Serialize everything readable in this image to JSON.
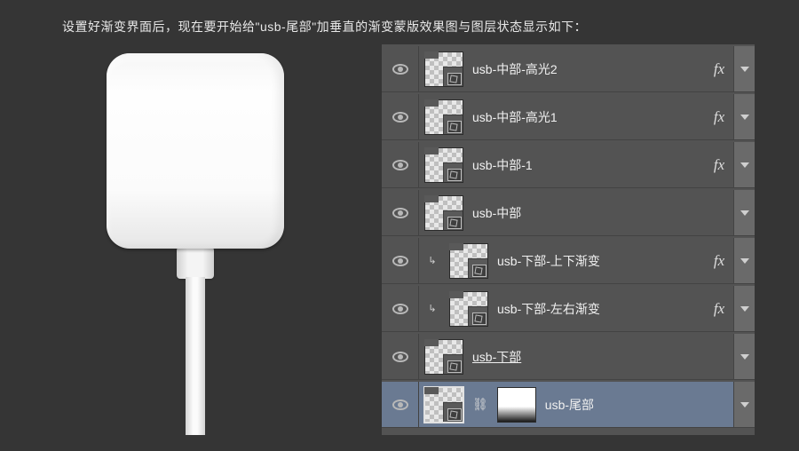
{
  "instruction": "设置好渐变界面后，现在要开始给\"usb-尾部\"加垂直的渐变蒙版效果图与图层状态显示如下：",
  "fx_label": "fx",
  "layers": [
    {
      "name": "usb-中部-高光2",
      "fx": true,
      "clipped": false,
      "underlined": false,
      "selected": false,
      "mask": false
    },
    {
      "name": "usb-中部-高光1",
      "fx": true,
      "clipped": false,
      "underlined": false,
      "selected": false,
      "mask": false
    },
    {
      "name": "usb-中部-1",
      "fx": true,
      "clipped": false,
      "underlined": false,
      "selected": false,
      "mask": false
    },
    {
      "name": "usb-中部",
      "fx": false,
      "clipped": false,
      "underlined": false,
      "selected": false,
      "mask": false
    },
    {
      "name": "usb-下部-上下渐变",
      "fx": true,
      "clipped": true,
      "underlined": false,
      "selected": false,
      "mask": false
    },
    {
      "name": "usb-下部-左右渐变",
      "fx": true,
      "clipped": true,
      "underlined": false,
      "selected": false,
      "mask": false
    },
    {
      "name": "usb-下部",
      "fx": false,
      "clipped": false,
      "underlined": true,
      "selected": false,
      "mask": false
    },
    {
      "name": "usb-尾部",
      "fx": false,
      "clipped": false,
      "underlined": false,
      "selected": true,
      "mask": true
    }
  ]
}
